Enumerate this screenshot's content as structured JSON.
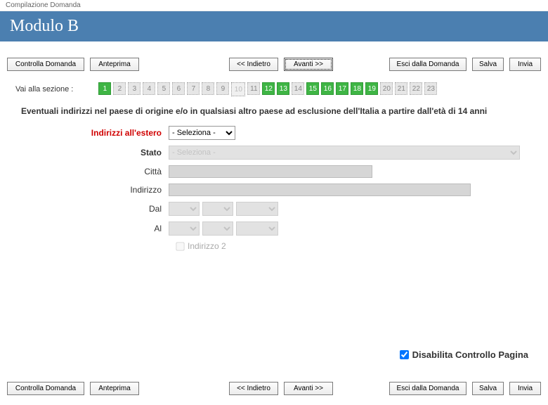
{
  "breadcrumb": "Compilazione Domanda",
  "title": "Modulo B",
  "toolbar": {
    "controlla": "Controlla Domanda",
    "anteprima": "Anteprima",
    "indietro": "<< Indietro",
    "avanti": "Avanti >>",
    "esci": "Esci dalla Domanda",
    "salva": "Salva",
    "invia": "Invia"
  },
  "sections_label": "Vai alla sezione :",
  "sections": [
    {
      "n": "1",
      "state": "green"
    },
    {
      "n": "2",
      "state": "grey"
    },
    {
      "n": "3",
      "state": "grey"
    },
    {
      "n": "4",
      "state": "grey"
    },
    {
      "n": "5",
      "state": "grey"
    },
    {
      "n": "6",
      "state": "grey"
    },
    {
      "n": "7",
      "state": "grey"
    },
    {
      "n": "8",
      "state": "grey"
    },
    {
      "n": "9",
      "state": "grey"
    },
    {
      "n": "10",
      "state": "current"
    },
    {
      "n": "11",
      "state": "grey"
    },
    {
      "n": "12",
      "state": "green"
    },
    {
      "n": "13",
      "state": "green"
    },
    {
      "n": "14",
      "state": "grey"
    },
    {
      "n": "15",
      "state": "green"
    },
    {
      "n": "16",
      "state": "green"
    },
    {
      "n": "17",
      "state": "green"
    },
    {
      "n": "18",
      "state": "green"
    },
    {
      "n": "19",
      "state": "green"
    },
    {
      "n": "20",
      "state": "grey"
    },
    {
      "n": "21",
      "state": "grey"
    },
    {
      "n": "22",
      "state": "grey"
    },
    {
      "n": "23",
      "state": "grey"
    }
  ],
  "instruction": "Eventuali indirizzi nel paese di origine e/o in qualsiasi altro paese ad esclusione dell'Italia a partire dall'età di 14 anni",
  "form": {
    "indirizzi_label": "Indirizzi all'estero",
    "indirizzi_select": "- Seleziona -",
    "stato_label": "Stato",
    "stato_select": "- Seleziona -",
    "citta_label": "Città",
    "indirizzo_label": "Indirizzo",
    "dal_label": "Dal",
    "al_label": "Al",
    "indirizzo2_label": "Indirizzo 2"
  },
  "disable_control": "Disabilita Controllo Pagina"
}
